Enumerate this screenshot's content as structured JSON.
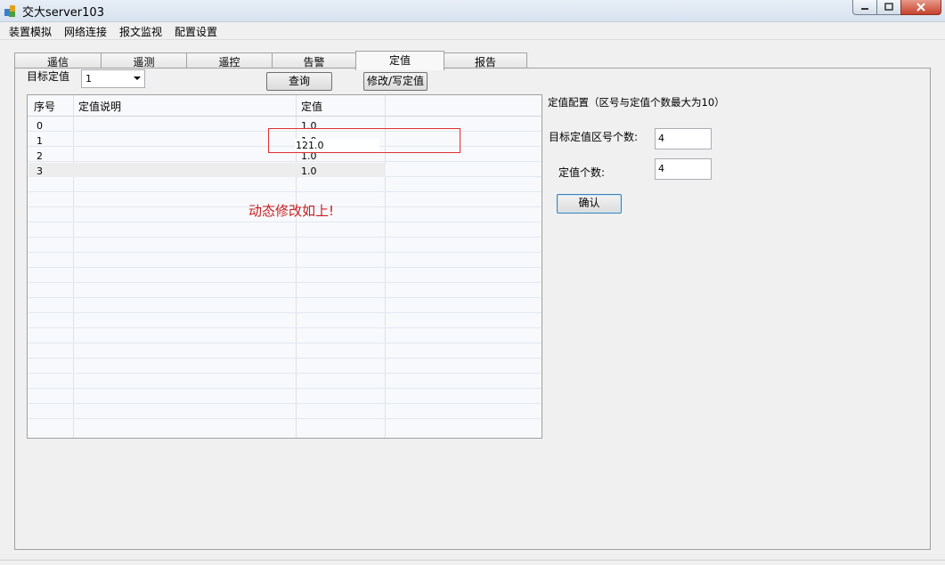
{
  "window": {
    "title": "交大server103"
  },
  "menu": [
    "装置模拟",
    "网络连接",
    "报文监视",
    "配置设置"
  ],
  "tabs": [
    "遥信",
    "遥测",
    "遥控",
    "告警",
    "定值",
    "报告"
  ],
  "active_tab": "定值",
  "target": {
    "label": "目标定值",
    "selected": "1"
  },
  "buttons": {
    "query": "查询",
    "modify": "修改/写定值",
    "confirm": "确认"
  },
  "table": {
    "headers": [
      "序号",
      "定值说明",
      "定值"
    ],
    "rows": [
      {
        "index": "0",
        "desc": "",
        "value": "1.0"
      },
      {
        "index": "1",
        "desc": "",
        "value": "1.0"
      },
      {
        "index": "2",
        "desc": "",
        "value": "1.0"
      },
      {
        "index": "3",
        "desc": "",
        "value": "1.0"
      }
    ],
    "editing_value": "121.0"
  },
  "annotation": "动态修改如上!",
  "config": {
    "title": "定值配置（区号与定值个数最大为10）",
    "zone_count_label": "目标定值区号个数:",
    "zone_count_value": "4",
    "value_count_label": "定值个数:",
    "value_count_value": "4"
  }
}
